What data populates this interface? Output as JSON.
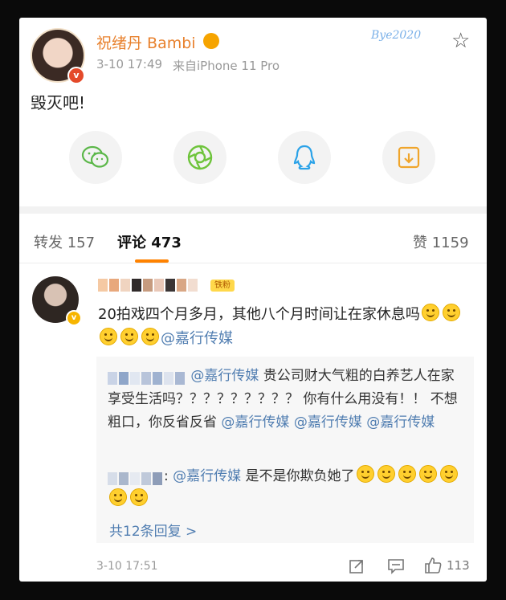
{
  "post": {
    "author": "祝绪丹 Bambi",
    "time": "3-10 17:49",
    "source": "来自iPhone 11 Pro",
    "content": "毁灭吧!",
    "badge_text": "Bye2020"
  },
  "share": [
    "wechat",
    "moments",
    "qq",
    "save-image"
  ],
  "stats": {
    "repost_label": "转发",
    "repost_count": "157",
    "comment_label": "评论",
    "comment_count": "473",
    "like_label": "赞",
    "like_count": "1159"
  },
  "comment": {
    "fan_badge": "铁粉",
    "text": "20拍戏四个月多月，其他八个月时间让在家休息吗",
    "mention": "@嘉行传媒",
    "time": "3-10 17:51",
    "like_count": "113",
    "replies": [
      {
        "mention1": "@嘉行传媒",
        "text": " 贵公司财大气粗的白养艺人在家享受生活吗？？？？？？？？？ 你有什么用没有！！ 不想粗口，你反省反省 ",
        "mention2": "@嘉行传媒",
        "mention3": "@嘉行传媒 @嘉行传媒"
      },
      {
        "colon": ":",
        "mention": "@嘉行传媒",
        "text": " 是不是你欺负她了"
      }
    ],
    "more_replies": "共12条回复 >"
  },
  "colors": {
    "accent": "#ff8200",
    "link": "#517eb1",
    "muted": "#9a9a9a"
  }
}
